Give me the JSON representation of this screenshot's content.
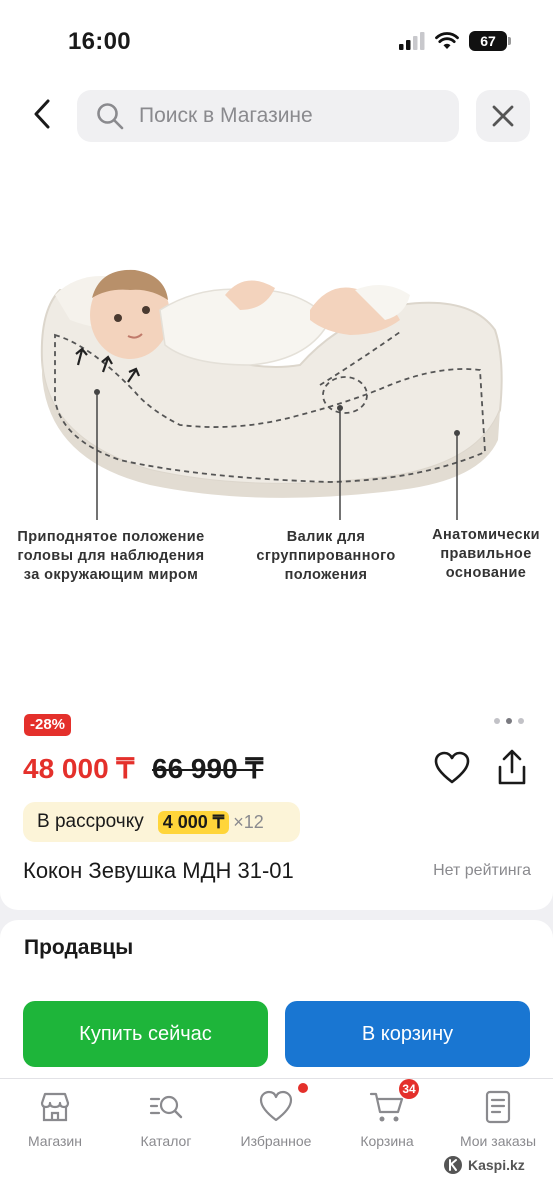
{
  "status_bar": {
    "time": "16:00",
    "battery": "67"
  },
  "search": {
    "placeholder": "Поиск в Магазине"
  },
  "product_image": {
    "callouts": [
      "Приподнятое положение\nголовы для наблюдения\nза окружающим миром",
      "Валик для\nсгруппированного\nположения",
      "Анатомически\nправильное\nоснование"
    ]
  },
  "product": {
    "discount": "-28%",
    "price": "48 000 ₸",
    "old_price": "66 990 ₸",
    "installment": {
      "label": "В рассрочку",
      "amount": "4 000 ₸",
      "multiplier": "×12"
    },
    "title": "Кокон Зевушка МДН 31-01",
    "rating": "Нет рейтинга",
    "gallery": {
      "total": 3,
      "active_index": 2
    }
  },
  "sellers": {
    "title": "Продавцы",
    "buy_now": "Купить сейчас",
    "add_to_cart": "В корзину"
  },
  "tabbar": {
    "items": [
      {
        "label": "Магазин",
        "icon": "store-icon"
      },
      {
        "label": "Каталог",
        "icon": "catalog-search-icon"
      },
      {
        "label": "Избранное",
        "icon": "heart-icon"
      },
      {
        "label": "Корзина",
        "icon": "cart-icon",
        "badge": "34"
      },
      {
        "label": "Мои заказы",
        "icon": "orders-icon"
      }
    ]
  },
  "watermark": "Kaspi.kz",
  "colors": {
    "accent_red": "#e4302b",
    "buy_green": "#1eb53a",
    "cart_blue": "#1976d2",
    "installment_yellow": "#ffd53a"
  }
}
